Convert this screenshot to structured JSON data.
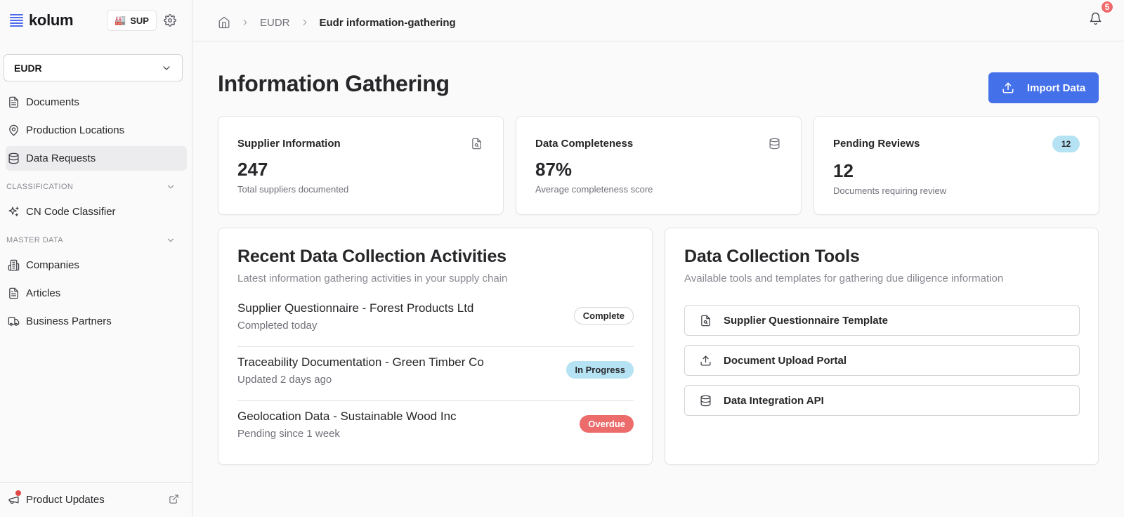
{
  "sidebar": {
    "brand": "kolum",
    "org_badge": {
      "emoji": "🏭",
      "label": "SUP"
    },
    "module_select": "EUDR",
    "items_top": [
      {
        "label": "Documents",
        "icon": "file-text-icon"
      },
      {
        "label": "Production Locations",
        "icon": "map-pin-icon"
      },
      {
        "label": "Data Requests",
        "icon": "database-icon",
        "active": true
      }
    ],
    "section_classification": "CLASSIFICATION",
    "items_classification": [
      {
        "label": "CN Code Classifier",
        "icon": "sparkles-icon"
      }
    ],
    "section_master": "MASTER DATA",
    "items_master": [
      {
        "label": "Companies",
        "icon": "building-icon"
      },
      {
        "label": "Articles",
        "icon": "file-text-icon"
      },
      {
        "label": "Business Partners",
        "icon": "truck-icon"
      }
    ],
    "footer_label": "Product Updates"
  },
  "header": {
    "breadcrumb": [
      "EUDR",
      "Eudr information-gathering"
    ],
    "notifications_count": "5"
  },
  "main": {
    "title": "Information Gathering",
    "import_button": "Import Data",
    "stats": [
      {
        "label": "Supplier Information",
        "value": "247",
        "sub": "Total suppliers documented",
        "icon": "file-search-icon"
      },
      {
        "label": "Data Completeness",
        "value": "87%",
        "sub": "Average completeness score",
        "icon": "database-icon"
      },
      {
        "label": "Pending Reviews",
        "value": "12",
        "sub": "Documents requiring review",
        "badge": "12"
      }
    ],
    "activities_panel": {
      "title": "Recent Data Collection Activities",
      "subtitle": "Latest information gathering activities in your supply chain",
      "items": [
        {
          "title": "Supplier Questionnaire - Forest Products Ltd",
          "sub": "Completed today",
          "status": "Complete"
        },
        {
          "title": "Traceability Documentation - Green Timber Co",
          "sub": "Updated 2 days ago",
          "status": "In Progress"
        },
        {
          "title": "Geolocation Data - Sustainable Wood Inc",
          "sub": "Pending since 1 week",
          "status": "Overdue"
        }
      ]
    },
    "tools_panel": {
      "title": "Data Collection Tools",
      "subtitle": "Available tools and templates for gathering due diligence information",
      "items": [
        {
          "label": "Supplier Questionnaire Template",
          "icon": "file-search-icon"
        },
        {
          "label": "Document Upload Portal",
          "icon": "upload-icon"
        },
        {
          "label": "Data Integration API",
          "icon": "database-icon"
        }
      ]
    }
  },
  "colors": {
    "accent": "#4470ea",
    "badge_blue": "#b6e3f3",
    "overdue_red": "#ec6b6b",
    "notification_red": "#ef6b6b"
  }
}
